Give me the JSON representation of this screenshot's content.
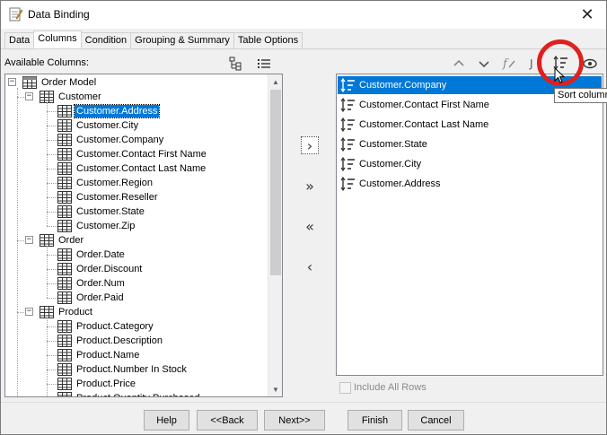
{
  "window": {
    "title": "Data Binding",
    "close_glyph": "✕"
  },
  "tabs": [
    {
      "label": "Data"
    },
    {
      "label": "Columns"
    },
    {
      "label": "Condition"
    },
    {
      "label": "Grouping & Summary"
    },
    {
      "label": "Table Options"
    }
  ],
  "active_tab": "Columns",
  "available": {
    "label": "Available Columns:",
    "tree": {
      "root": "Order Model",
      "groups": [
        {
          "name": "Customer",
          "items": [
            "Customer.Address",
            "Customer.City",
            "Customer.Company",
            "Customer.Contact First Name",
            "Customer.Contact Last Name",
            "Customer.Region",
            "Customer.Reseller",
            "Customer.State",
            "Customer.Zip"
          ]
        },
        {
          "name": "Order",
          "items": [
            "Order.Date",
            "Order.Discount",
            "Order.Num",
            "Order.Paid"
          ]
        },
        {
          "name": "Product",
          "items": [
            "Product.Category",
            "Product.Description",
            "Product.Name",
            "Product.Number In Stock",
            "Product.Price",
            "Product.Quantity Purchased"
          ]
        }
      ],
      "selected": "Customer.Address"
    }
  },
  "move_buttons": {
    "add": "›",
    "add_all": "»",
    "remove_all": "«",
    "remove": "‹"
  },
  "selected_columns": {
    "items": [
      "Customer.Company",
      "Customer.Contact First Name",
      "Customer.Contact Last Name",
      "Customer.State",
      "Customer.City",
      "Customer.Address"
    ],
    "selected": "Customer.Company",
    "include_all_rows": "Include All Rows"
  },
  "tooltip": "Sort column",
  "buttons": {
    "help": "Help",
    "back": "<<Back",
    "next": "Next>>",
    "finish": "Finish",
    "cancel": "Cancel"
  },
  "colors": {
    "selection": "#0078d7",
    "highlight_ring": "#e0201c"
  },
  "icons": [
    "tree-view-icon",
    "list-view-icon",
    "move-up-icon",
    "move-down-icon",
    "formula-icon",
    "sort-column-icon",
    "visibility-icon",
    "table-icon",
    "data-model-icon"
  ]
}
